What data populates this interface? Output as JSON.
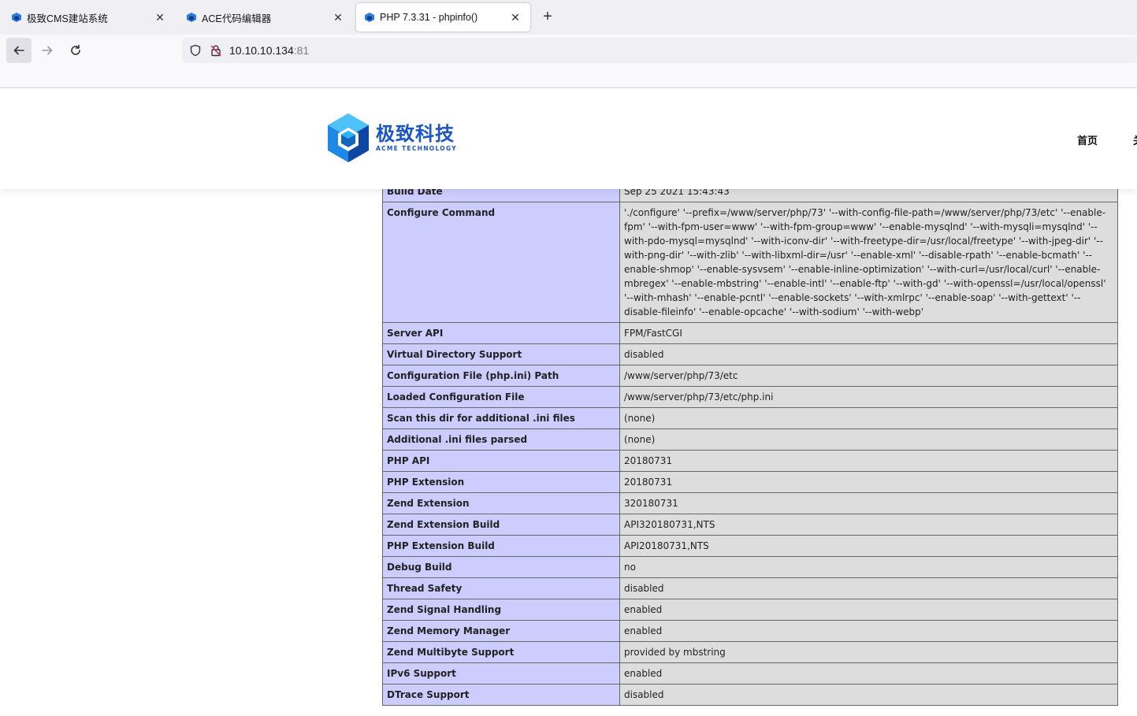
{
  "browser": {
    "tabs": [
      {
        "title": "极致CMS建站系统",
        "active": false
      },
      {
        "title": "ACE代码编辑器",
        "active": false
      },
      {
        "title": "PHP 7.3.31 - phpinfo()",
        "active": true
      }
    ],
    "url": {
      "host": "10.10.10.134",
      "port": ":81"
    }
  },
  "site": {
    "logo_cn": "极致科技",
    "logo_en": "ACME TECHNOLOGY",
    "nav": [
      "首页",
      "关"
    ]
  },
  "phpinfo": {
    "rows": [
      {
        "key": "",
        "value": ""
      },
      {
        "key": "Build Date",
        "value": "Sep 25 2021 15:43:43"
      },
      {
        "key": "Configure Command",
        "value": "'./configure' '--prefix=/www/server/php/73' '--with-config-file-path=/www/server/php/73/etc' '--enable-fpm' '--with-fpm-user=www' '--with-fpm-group=www' '--enable-mysqlnd' '--with-mysqli=mysqlnd' '--with-pdo-mysql=mysqlnd' '--with-iconv-dir' '--with-freetype-dir=/usr/local/freetype' '--with-jpeg-dir' '--with-png-dir' '--with-zlib' '--with-libxml-dir=/usr' '--enable-xml' '--disable-rpath' '--enable-bcmath' '--enable-shmop' '--enable-sysvsem' '--enable-inline-optimization' '--with-curl=/usr/local/curl' '--enable-mbregex' '--enable-mbstring' '--enable-intl' '--enable-ftp' '--with-gd' '--with-openssl=/usr/local/openssl' '--with-mhash' '--enable-pcntl' '--enable-sockets' '--with-xmlrpc' '--enable-soap' '--with-gettext' '--disable-fileinfo' '--enable-opcache' '--with-sodium' '--with-webp'"
      },
      {
        "key": "Server API",
        "value": "FPM/FastCGI"
      },
      {
        "key": "Virtual Directory Support",
        "value": "disabled"
      },
      {
        "key": "Configuration File (php.ini) Path",
        "value": "/www/server/php/73/etc"
      },
      {
        "key": "Loaded Configuration File",
        "value": "/www/server/php/73/etc/php.ini"
      },
      {
        "key": "Scan this dir for additional .ini files",
        "value": "(none)"
      },
      {
        "key": "Additional .ini files parsed",
        "value": "(none)"
      },
      {
        "key": "PHP API",
        "value": "20180731"
      },
      {
        "key": "PHP Extension",
        "value": "20180731"
      },
      {
        "key": "Zend Extension",
        "value": "320180731"
      },
      {
        "key": "Zend Extension Build",
        "value": "API320180731,NTS"
      },
      {
        "key": "PHP Extension Build",
        "value": "API20180731,NTS"
      },
      {
        "key": "Debug Build",
        "value": "no"
      },
      {
        "key": "Thread Safety",
        "value": "disabled"
      },
      {
        "key": "Zend Signal Handling",
        "value": "enabled"
      },
      {
        "key": "Zend Memory Manager",
        "value": "enabled"
      },
      {
        "key": "Zend Multibyte Support",
        "value": "provided by mbstring"
      },
      {
        "key": "IPv6 Support",
        "value": "enabled"
      },
      {
        "key": "DTrace Support",
        "value": "disabled"
      }
    ]
  },
  "colors": {
    "key_bg": "#ccccff",
    "value_bg": "#dddddd",
    "brand": "#1a56c4"
  }
}
